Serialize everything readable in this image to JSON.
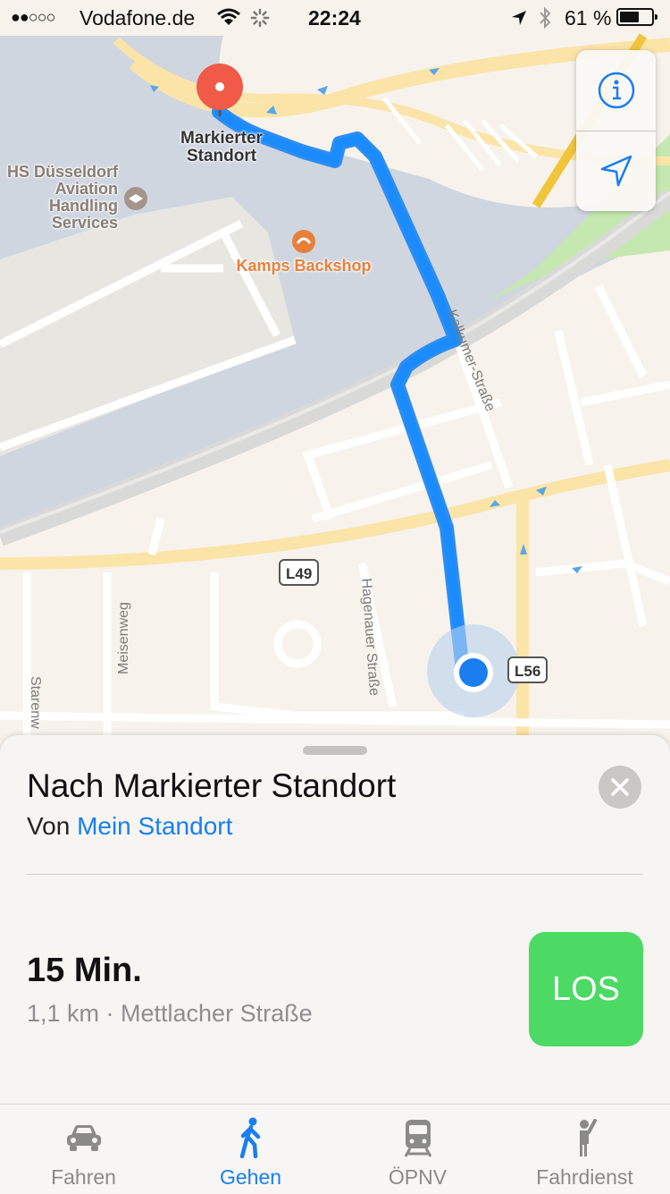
{
  "status_bar": {
    "signal": "●●○○○",
    "carrier": "Vodafone.de",
    "time": "22:24",
    "battery_percent": "61 %",
    "battery_level": 0.61
  },
  "map": {
    "labels": {
      "destination": "Markierter\nStandort",
      "poi_school": "HS Düsseldorf\nAviation\nHandling\nServices",
      "poi_bakery": "Kamps Backshop",
      "street_kalkumer": "Kalkumer-Straße",
      "street_hagenauer": "Hagenauer Straße",
      "street_meisenweg": "Meisenweg",
      "street_starenweg": "Starenw"
    },
    "shields": {
      "l49": "L49",
      "l56": "L56"
    },
    "colors": {
      "route": "#1a8cff",
      "water": "#cfd6e0",
      "land": "#f7f3ec",
      "major_road": "#fbe4a8",
      "green": "#c5e8b0",
      "poi_orange": "#e8803a",
      "pin": "#f05a46"
    }
  },
  "controls": {
    "info_icon": "info-icon",
    "location_icon": "location-arrow-icon"
  },
  "card": {
    "title": "Nach Markierter Standort",
    "from_prefix": "Von",
    "from_link": "Mein Standort",
    "duration": "15 Min.",
    "details": "1,1 km · Mettlacher Straße",
    "go_label": "LOS",
    "go_color": "#4cd964"
  },
  "tabs": [
    {
      "label": "Fahren",
      "icon": "car-icon",
      "active": false
    },
    {
      "label": "Gehen",
      "icon": "walking-icon",
      "active": true
    },
    {
      "label": "ÖPNV",
      "icon": "train-icon",
      "active": false
    },
    {
      "label": "Fahrdienst",
      "icon": "ride-icon",
      "active": false
    }
  ]
}
